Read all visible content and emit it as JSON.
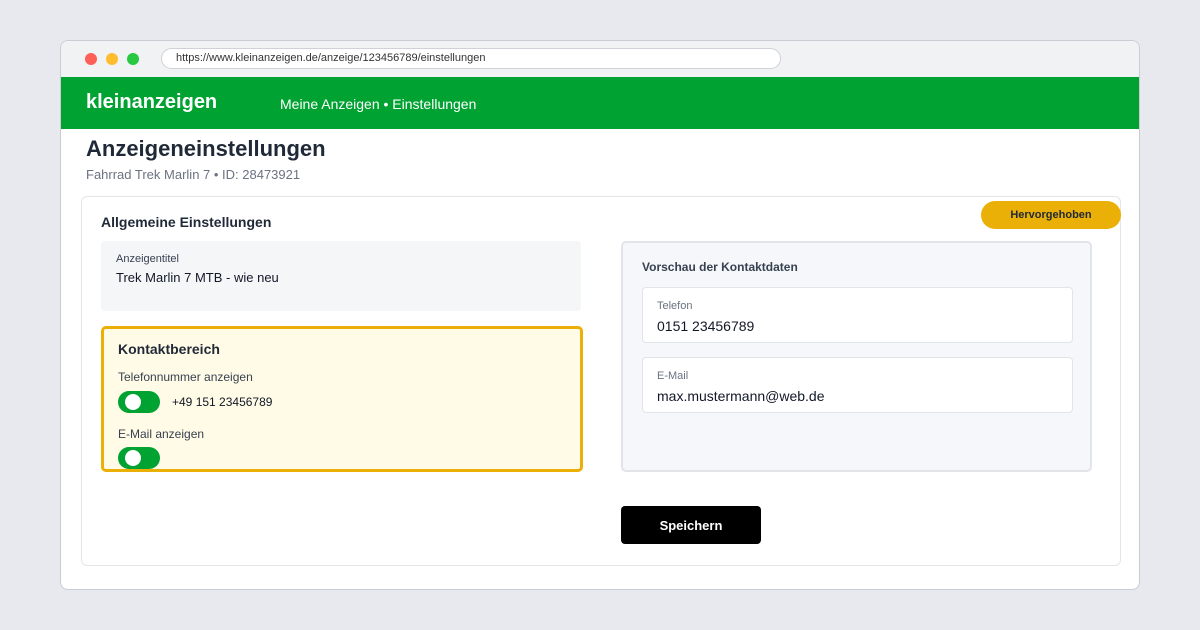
{
  "browser": {
    "url": "https://www.kleinanzeigen.de/anzeige/123456789/einstellungen"
  },
  "header": {
    "brand": "kleinanzeigen",
    "breadcrumb": "Meine Anzeigen • Einstellungen"
  },
  "page": {
    "title": "Anzeigeneinstellungen",
    "subtitle": "Fahrrad Trek Marlin 7 • ID: 28473921"
  },
  "general": {
    "heading": "Allgemeine Einstellungen",
    "badge": "Hervorgehoben",
    "ad_title_label": "Anzeigentitel",
    "ad_title_value": "Trek Marlin 7 MTB - wie neu"
  },
  "contact": {
    "heading": "Kontaktbereich",
    "phone_label": "Telefonnummer anzeigen",
    "phone_enabled": true,
    "phone_number": "+49 151 23456789",
    "email_label": "E-Mail anzeigen",
    "email_enabled": true
  },
  "preview": {
    "heading": "Vorschau der Kontaktdaten",
    "phone_label": "Telefon",
    "phone_value": "0151 23456789",
    "email_label": "E-Mail",
    "email_value": "max.mustermann@web.de"
  },
  "actions": {
    "save_label": "Speichern"
  },
  "colors": {
    "brand_green": "#00a231",
    "highlight_yellow": "#ebb007",
    "highlight_bg": "#fffbe6"
  }
}
